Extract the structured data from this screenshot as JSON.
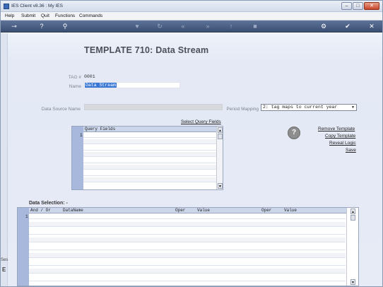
{
  "window": {
    "title": "IES Client v8.36 : My IES",
    "min_glyph": "–",
    "max_glyph": "□",
    "close_glyph": "✕"
  },
  "menu": {
    "items": [
      "Help",
      "Submit",
      "Quit",
      "Functions",
      "Commands"
    ]
  },
  "toolbar": {
    "icons": [
      "key-icon",
      "help-icon",
      "search-icon",
      "heart-icon",
      "refresh-icon",
      "rewind-icon",
      "fast-forward-icon",
      "upload-icon",
      "stop-icon",
      "settings-icon",
      "check-icon",
      "close-icon"
    ],
    "glyphs": {
      "key": "⊸",
      "help": "?",
      "search": "⚲",
      "heart": "♥",
      "refresh": "↻",
      "rewind": "«",
      "ffwd": "»",
      "upload": "↑",
      "stop": "■",
      "settings": "⚙",
      "check": "✔",
      "close": "✕"
    }
  },
  "page": {
    "title": "TEMPLATE 710: Data Stream"
  },
  "form": {
    "tag_label": "TAG #",
    "tag_value": "0001",
    "name_label": "Name",
    "name_value": "Data Stream",
    "data_source_label": "Data Source Name",
    "data_source_value": "",
    "period_mapping_label": "Period Mapping",
    "period_mapping_value": "2: tag maps to current year",
    "dropdown_arrow": "▼"
  },
  "query_fields": {
    "link_label": "Select Query Fields",
    "header": "Query Fields",
    "rows": [
      "1",
      "",
      "",
      "",
      "",
      "",
      "",
      ""
    ]
  },
  "actions": {
    "help_glyph": "?",
    "remove_template": "Remove Template",
    "copy_template": "Copy Template",
    "reveal_logic": "Reveal Logic",
    "save": "Save"
  },
  "data_selection": {
    "title": "Data Selection: -",
    "columns": [
      "And / Or",
      "DataName",
      "Oper",
      "Value",
      "Oper",
      "Value"
    ],
    "rows": [
      "1",
      "",
      "",
      "",
      "",
      "",
      "",
      "",
      ""
    ]
  },
  "scrollbar": {
    "up": "▲",
    "down": "▼"
  },
  "edge": {
    "left_text": "Ses",
    "left_glyph": "E"
  }
}
